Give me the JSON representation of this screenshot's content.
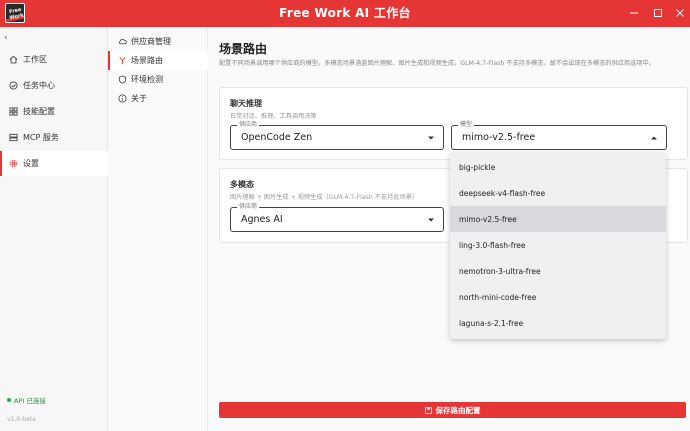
{
  "window": {
    "title": "Free Work  AI 工作台",
    "logo_text": "Free Work"
  },
  "sidebar": {
    "collapse_glyph": "‹",
    "items": [
      {
        "label": "工作区",
        "icon": "home-icon"
      },
      {
        "label": "任务中心",
        "icon": "check-circle-icon"
      },
      {
        "label": "技能配置",
        "icon": "grid-icon"
      },
      {
        "label": "MCP 服务",
        "icon": "server-icon"
      },
      {
        "label": "设置",
        "icon": "gear-icon",
        "active": true
      }
    ],
    "api_status": "API 已连接",
    "version": "v1.0-beta"
  },
  "submenu": {
    "items": [
      {
        "label": "供应商管理",
        "icon": "cloud-icon"
      },
      {
        "label": "场景路由",
        "icon": "route-icon",
        "active": true
      },
      {
        "label": "环境检测",
        "icon": "shield-icon"
      },
      {
        "label": "关于",
        "icon": "info-icon"
      }
    ]
  },
  "main": {
    "title": "场景路由",
    "description": "配置不同场景调用哪个供应商的模型。多模态场景涵盖图片理解、图片生成和视频生成，GLM-4.7-Flash 不支持多模态，故不会出现在多模态的供应商选项中。"
  },
  "chat_card": {
    "title": "聊天推理",
    "subtitle": "日常对话、推理、工具调用决策",
    "provider_legend": "供应商",
    "provider_value": "OpenCode Zen",
    "model_legend": "模型",
    "model_value": "mimo-v2.5-free"
  },
  "multimodal_card": {
    "title": "多模态",
    "subtitle": "图片理解 + 图片生成 + 视频生成（GLM-4.7-Flash 不支持此场景）",
    "provider_legend": "供应商",
    "provider_value": "Agnes AI"
  },
  "model_dropdown": {
    "options": [
      "big-pickle",
      "deepseek-v4-flash-free",
      "mimo-v2.5-free",
      "ling-3.0-flash-free",
      "nemotron-3-ultra-free",
      "north-mini-code-free",
      "laguna-s-2.1-free"
    ],
    "selected_index": 2
  },
  "save_button": {
    "label": "保存路由配置"
  },
  "colors": {
    "accent": "#e53535",
    "status_ok": "#2bb24c"
  }
}
